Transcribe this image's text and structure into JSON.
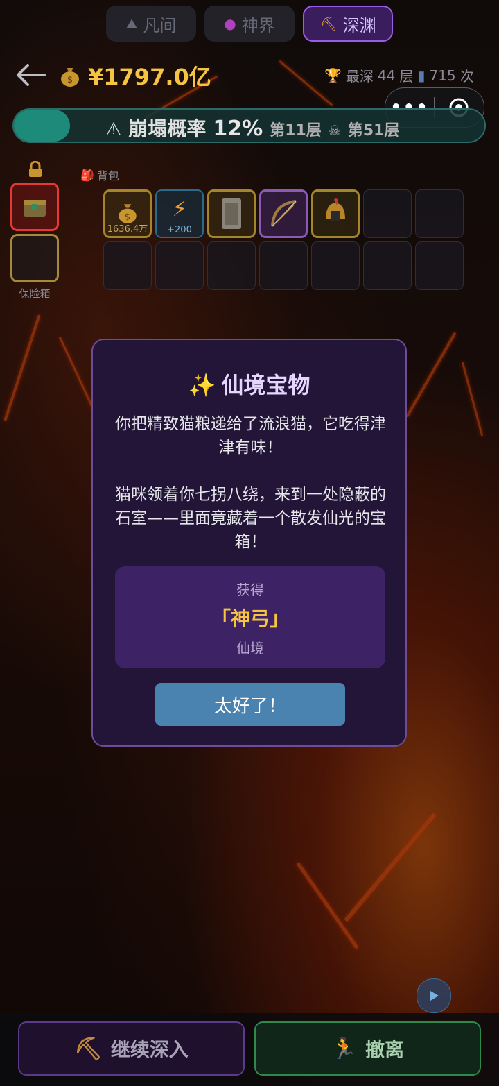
{
  "tabs": [
    {
      "label": "凡间",
      "icon": "mountain-icon",
      "active": false
    },
    {
      "label": "神界",
      "icon": "crystal-ball-icon",
      "active": false
    },
    {
      "label": "深渊",
      "icon": "pickaxe-icon",
      "active": true
    }
  ],
  "header": {
    "money": "¥1797.0亿",
    "deepest_label": "最深",
    "deepest_value": "44",
    "deepest_unit": "层",
    "runs_value": "715",
    "runs_unit": "次"
  },
  "capsule": {
    "more_label": "•••"
  },
  "collapse": {
    "label": "崩塌概率",
    "percent": "12%",
    "progress": 0.12,
    "current_floor": "第11层",
    "max_floor": "第51层"
  },
  "vault": {
    "label": "保险箱"
  },
  "backpack": {
    "label": "背包",
    "items": [
      {
        "type": "money",
        "caption": "1636.4万",
        "rarity": "gold"
      },
      {
        "type": "lightning",
        "caption": "+200",
        "rarity": "blue"
      },
      {
        "type": "tablet",
        "caption": "",
        "rarity": "gold"
      },
      {
        "type": "bow",
        "caption": "",
        "rarity": "purple"
      },
      {
        "type": "helmet",
        "caption": "",
        "rarity": "gold"
      }
    ]
  },
  "modal": {
    "title": "仙境宝物",
    "paragraph1": "你把精致猫粮递给了流浪猫，它吃得津津有味！",
    "paragraph2": "猫咪领着你七拐八绕，来到一处隐蔽的石室——里面竟藏着一个散发仙光的宝箱！",
    "reward_label": "获得",
    "reward_item": "「神弓」",
    "reward_tier": "仙境",
    "ok_button": "太好了！"
  },
  "bottom": {
    "continue_label": "继续深入",
    "retreat_label": "撤离"
  },
  "colors": {
    "accent_gold": "#f5c542",
    "modal_bg": "#221538",
    "ok_button": "#4a82b0"
  }
}
